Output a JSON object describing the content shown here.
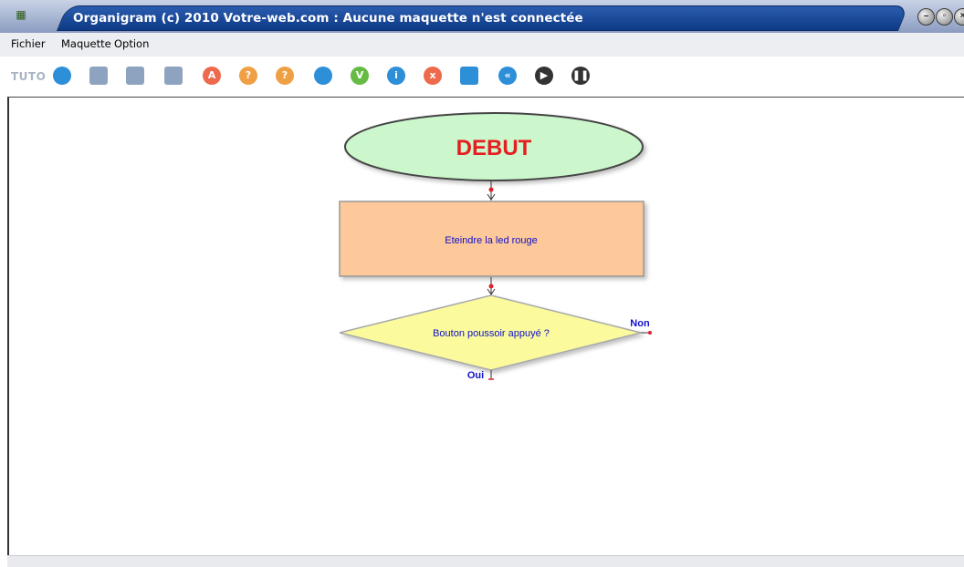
{
  "window": {
    "title": "Organigram (c) 2010 Votre-web.com :  Aucune maquette n'est connectée"
  },
  "menu": {
    "items": [
      {
        "label": "Fichier"
      },
      {
        "label": "Maquette"
      },
      {
        "label": "Option"
      }
    ]
  },
  "toolbar": {
    "tuto_label": "TUTO",
    "buttons": [
      {
        "icon": "settings-icon",
        "color": "#2d8fd8"
      },
      {
        "icon": "monitor-icon",
        "color": "#8ea3bf"
      },
      {
        "icon": "save-icon",
        "color": "#8ea3bf"
      },
      {
        "icon": "document-icon",
        "color": "#8ea3bf"
      },
      {
        "icon": "action-a-icon",
        "color": "#ee6a4c",
        "glyph": "A"
      },
      {
        "icon": "question-icon",
        "color": "#f0a044",
        "glyph": "?"
      },
      {
        "icon": "subroutine-icon",
        "color": "#f0a044",
        "glyph": "?"
      },
      {
        "icon": "clock-icon",
        "color": "#2d8fd8"
      },
      {
        "icon": "variable-icon",
        "color": "#66bb44",
        "glyph": "V"
      },
      {
        "icon": "info-icon",
        "color": "#2d8fd8",
        "glyph": "i"
      },
      {
        "icon": "delete-icon",
        "color": "#ee6a4c",
        "glyph": "x"
      },
      {
        "icon": "list-icon",
        "color": "#2d8fd8"
      },
      {
        "icon": "rewind-icon",
        "color": "#2d8fd8",
        "glyph": "«"
      },
      {
        "icon": "play-icon",
        "color": "#333333",
        "glyph": "▶"
      },
      {
        "icon": "pause-icon",
        "color": "#333333",
        "glyph": "❚❚"
      }
    ]
  },
  "flowchart": {
    "start_label": "DEBUT",
    "action_label": "Eteindre la led rouge",
    "decision_label": "Bouton poussoir appuyé ?",
    "yes_label": "Oui",
    "no_label": "Non",
    "colors": {
      "start_fill": "#ccf7cc",
      "start_text": "#e51f1f",
      "action_fill": "#fdc99a",
      "decision_fill": "#fbfb9e",
      "label_text": "#1010c8"
    }
  }
}
